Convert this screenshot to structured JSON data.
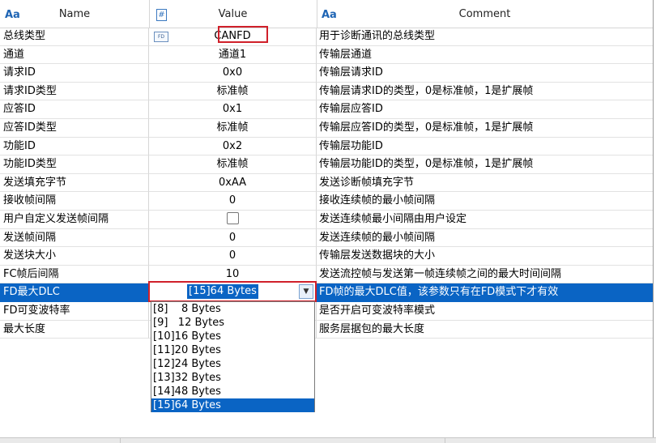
{
  "columns": [
    {
      "icon": "Aa",
      "title": "Name"
    },
    {
      "icon": "#",
      "title": "Value"
    },
    {
      "icon": "Aa",
      "title": "Comment"
    }
  ],
  "rows": [
    {
      "name": "总线类型",
      "value": "CANFD",
      "comment": "用于诊断通讯的总线类型",
      "icon_label": "FD"
    },
    {
      "name": "通道",
      "value": "通道1",
      "comment": "传输层通道"
    },
    {
      "name": "请求ID",
      "value": "0x0",
      "comment": "传输层请求ID"
    },
    {
      "name": "请求ID类型",
      "value": "标准帧",
      "comment": "传输层请求ID的类型，0是标准帧，1是扩展帧"
    },
    {
      "name": "应答ID",
      "value": "0x1",
      "comment": "传输层应答ID"
    },
    {
      "name": "应答ID类型",
      "value": "标准帧",
      "comment": "传输层应答ID的类型，0是标准帧，1是扩展帧"
    },
    {
      "name": "功能ID",
      "value": "0x2",
      "comment": "传输层功能ID"
    },
    {
      "name": "功能ID类型",
      "value": "标准帧",
      "comment": "传输层功能ID的类型，0是标准帧，1是扩展帧"
    },
    {
      "name": "发送填充字节",
      "value": "0xAA",
      "comment": "发送诊断帧填充字节"
    },
    {
      "name": "接收帧间隔",
      "value": "0",
      "comment": "接收连续帧的最小帧间隔"
    },
    {
      "name": "用户自定义发送帧间隔",
      "value": "",
      "comment": "发送连续帧最小间隔由用户设定",
      "checkbox": true,
      "checked": false
    },
    {
      "name": "发送帧间隔",
      "value": "0",
      "comment": "发送连续帧的最小帧间隔"
    },
    {
      "name": "发送块大小",
      "value": "0",
      "comment": "传输层发送数据块的大小"
    },
    {
      "name": "FC帧后间隔",
      "value": "10",
      "comment": "发送流控帧与发送第一帧连续帧之间的最大时间间隔"
    },
    {
      "name": "FD最大DLC",
      "value": "[15]64 Bytes",
      "comment": "FD帧的最大DLC值，该参数只有在FD模式下才有效"
    },
    {
      "name": "FD可变波特率",
      "value": "",
      "comment": "是否开启可变波特率模式"
    },
    {
      "name": "最大长度",
      "value": "",
      "comment": "服务层据包的最大长度"
    }
  ],
  "dlc_dropdown": {
    "selected": "[15]64 Bytes",
    "options": [
      "[8]    8 Bytes",
      "[9]   12 Bytes",
      "[10]16 Bytes",
      "[11]20 Bytes",
      "[12]24 Bytes",
      "[13]32 Bytes",
      "[14]48 Bytes",
      "[15]64 Bytes"
    ]
  },
  "colors": {
    "selection": "#0a64c4",
    "highlight_box": "#d0202a",
    "header_icon": "#1e64b4"
  }
}
